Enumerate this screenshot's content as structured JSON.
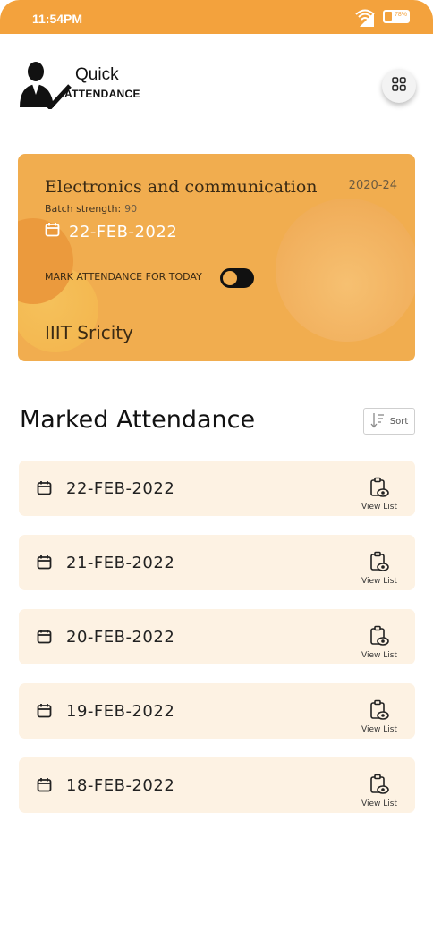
{
  "status_bar": {
    "time": "11:54PM",
    "battery": "78%",
    "accent": "#f3a23d"
  },
  "header": {
    "logo_top": "Quick",
    "logo_bottom": "ATTENDANCE",
    "menu_icon": "grid-icon"
  },
  "class_card": {
    "course": "Electronics and communication",
    "year": "2020-24",
    "strength_label": "Batch strength:",
    "strength_value": "90",
    "date": "22-FEB-2022",
    "mark_label": "MARK ATTENDANCE FOR TODAY",
    "toggle_on": false,
    "institute": "IIIT Sricity",
    "background": "#f1ad4f"
  },
  "marked": {
    "title": "Marked Attendance",
    "sort_label": "Sort",
    "view_label": "View List",
    "rows": [
      {
        "date": "22-FEB-2022"
      },
      {
        "date": "21-FEB-2022"
      },
      {
        "date": "20-FEB-2022"
      },
      {
        "date": "19-FEB-2022"
      },
      {
        "date": "18-FEB-2022"
      }
    ],
    "row_background": "#fdf2e3"
  }
}
